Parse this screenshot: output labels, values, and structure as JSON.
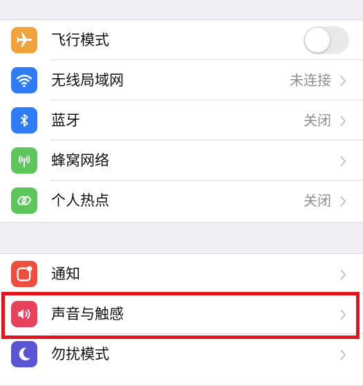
{
  "colors": {
    "airplane": "#f1a33b",
    "wifi": "#2f7cf6",
    "bluetooth": "#2f7cf6",
    "cellular": "#5cc65b",
    "hotspot": "#5cc65b",
    "notifications": "#ef4d3f",
    "sounds": "#e8415c",
    "dnd": "#5b55d6",
    "highlight": "#e4131b"
  },
  "group1": [
    {
      "icon": "airplane-icon",
      "label": "飞行模式",
      "toggle": false
    },
    {
      "icon": "wifi-icon",
      "label": "无线局域网",
      "value": "未连接"
    },
    {
      "icon": "bluetooth-icon",
      "label": "蓝牙",
      "value": "关闭"
    },
    {
      "icon": "cellular-icon",
      "label": "蜂窝网络",
      "value": ""
    },
    {
      "icon": "hotspot-icon",
      "label": "个人热点",
      "value": "关闭"
    }
  ],
  "group2": [
    {
      "icon": "notifications-icon",
      "label": "通知"
    },
    {
      "icon": "sounds-icon",
      "label": "声音与触感"
    },
    {
      "icon": "moon-icon",
      "label": "勿扰模式"
    }
  ]
}
